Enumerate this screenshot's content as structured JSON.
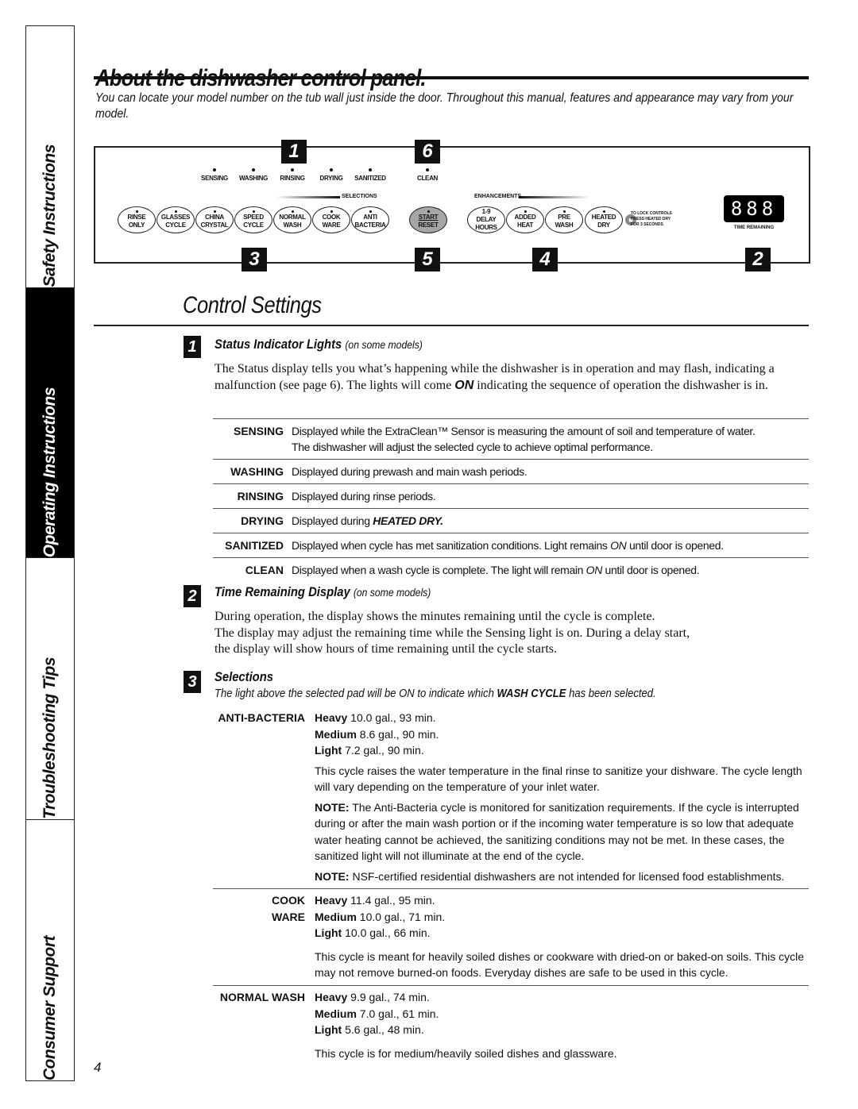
{
  "sidebar": {
    "tabs": [
      {
        "label": "Safety Instructions",
        "active": false
      },
      {
        "label": "Operating Instructions",
        "active": true
      },
      {
        "label": "Troubleshooting Tips",
        "active": false
      },
      {
        "label": "Consumer Support",
        "active": false
      }
    ]
  },
  "header": {
    "title": "About the dishwasher control panel.",
    "intro": "You can locate your model number on the tub wall just inside the door. Throughout this manual, features and appearance may vary from your model."
  },
  "panel": {
    "callouts": [
      "1",
      "6",
      "3",
      "5",
      "4",
      "2"
    ],
    "indicators": [
      "SENSING",
      "WASHING",
      "RINSING",
      "DRYING",
      "SANITIZED",
      "CLEAN"
    ],
    "selections_label": "SELECTIONS",
    "enhancements_label": "ENHANCEMENTS",
    "pads": [
      {
        "l1": "RINSE",
        "l2": "ONLY"
      },
      {
        "l1": "GLASSES",
        "l2": "CYCLE"
      },
      {
        "l1": "CHINA",
        "l2": "CRYSTAL"
      },
      {
        "l1": "SPEED",
        "l2": "CYCLE"
      },
      {
        "l1": "NORMAL",
        "l2": "WASH"
      },
      {
        "l1": "COOK",
        "l2": "WARE"
      },
      {
        "l1": "ANTI",
        "l2": "BACTERIA"
      }
    ],
    "start_pad": {
      "l1": "START",
      "l2": "RESET"
    },
    "enh_pads": [
      {
        "l0": "1-9",
        "l1": "DELAY",
        "l2": "HOURS"
      },
      {
        "l1": "ADDED",
        "l2": "HEAT"
      },
      {
        "l1": "PRE",
        "l2": "WASH"
      },
      {
        "l1": "HEATED",
        "l2": "DRY"
      }
    ],
    "lock_text": [
      "TO LOCK CONTROLS",
      "PRESS HEATED DRY",
      "FOR 3 SECONDS"
    ],
    "display_value": "888",
    "display_label": "TIME REMAINING"
  },
  "control_settings": {
    "title": "Control Settings",
    "sections": [
      {
        "num": "1",
        "heading": "Status Indicator Lights",
        "sub": "(on some models)",
        "body_pre": "The Status display tells you what’s happening while the dishwasher is in operation and may flash, indicating a malfunction (see page 6). The lights will come ",
        "body_em": "ON",
        "body_post": " indicating the sequence of operation the dishwasher is in.",
        "rows": [
          {
            "label": "SENSING",
            "text": "Displayed while the ExtraClean™ Sensor is measuring the amount of soil and temperature of water.",
            "text2": "The dishwasher will adjust the selected cycle to achieve optimal performance."
          },
          {
            "label": "WASHING",
            "text": "Displayed during prewash and main wash periods."
          },
          {
            "label": "RINSING",
            "text": "Displayed during rinse periods."
          },
          {
            "label": "DRYING",
            "text": "Displayed during ",
            "em": "HEATED DRY."
          },
          {
            "label": "SANITIZED",
            "text": "Displayed when cycle has met sanitization conditions. Light remains ",
            "em_i": "ON",
            "text_after": " until door is opened."
          },
          {
            "label": "CLEAN",
            "text": "Displayed when a wash cycle is complete. The light will remain ",
            "em_i": "ON",
            "text_after": " until door is opened."
          }
        ]
      },
      {
        "num": "2",
        "heading": "Time Remaining Display",
        "sub": "(on some models)",
        "body": [
          "During operation, the display shows the minutes remaining until the cycle is complete.",
          "The display may adjust the remaining time while the Sensing light is on. During a delay start,",
          "the display will show hours of time remaining until the cycle starts."
        ]
      },
      {
        "num": "3",
        "heading": "Selections",
        "sub_pre": "The light above the selected pad will be ON to indicate which ",
        "sub_bold": "WASH CYCLE",
        "sub_post": " has been selected.",
        "cycles": [
          {
            "label": "ANTI-BACTERIA",
            "levels": [
              {
                "name": "Heavy",
                "value": "10.0 gal., 93 min."
              },
              {
                "name": "Medium",
                "value": "8.6 gal., 90 min."
              },
              {
                "name": "Light",
                "value": "7.2 gal., 90 min."
              }
            ],
            "desc": "This cycle raises the water temperature in the final rinse to sanitize your dishware. The cycle length will vary depending on the temperature of your inlet water.",
            "notes": [
              {
                "label": "NOTE:",
                "text": " The Anti-Bacteria cycle is monitored for sanitization requirements. If the cycle is interrupted during or after the main wash portion or if the incoming water temperature is so low that adequate water heating cannot be achieved, the sanitizing conditions may not be met. In these cases, the sanitized light will not illuminate at the end of the cycle."
              },
              {
                "label": "NOTE:",
                "text": " NSF-certified residential dishwashers are not intended for licensed food establishments."
              }
            ]
          },
          {
            "label": "COOK WARE",
            "label_l1": "COOK",
            "label_l2": "WARE",
            "levels": [
              {
                "name": "Heavy",
                "value": "11.4 gal., 95 min."
              },
              {
                "name": "Medium",
                "value": "10.0 gal., 71 min."
              },
              {
                "name": "Light",
                "value": "10.0 gal., 66 min."
              }
            ],
            "desc": "This cycle is meant for heavily soiled dishes or cookware with dried-on or baked-on soils. This cycle may not remove burned-on foods. Everyday dishes are safe to be used in this cycle."
          },
          {
            "label": "NORMAL WASH",
            "levels": [
              {
                "name": "Heavy",
                "value": "9.9 gal., 74 min."
              },
              {
                "name": "Medium",
                "value": "7.0 gal., 61 min."
              },
              {
                "name": "Light",
                "value": "5.6 gal., 48 min."
              }
            ],
            "desc": "This cycle is for medium/heavily soiled dishes and glassware."
          }
        ]
      }
    ]
  },
  "page_number": "4"
}
